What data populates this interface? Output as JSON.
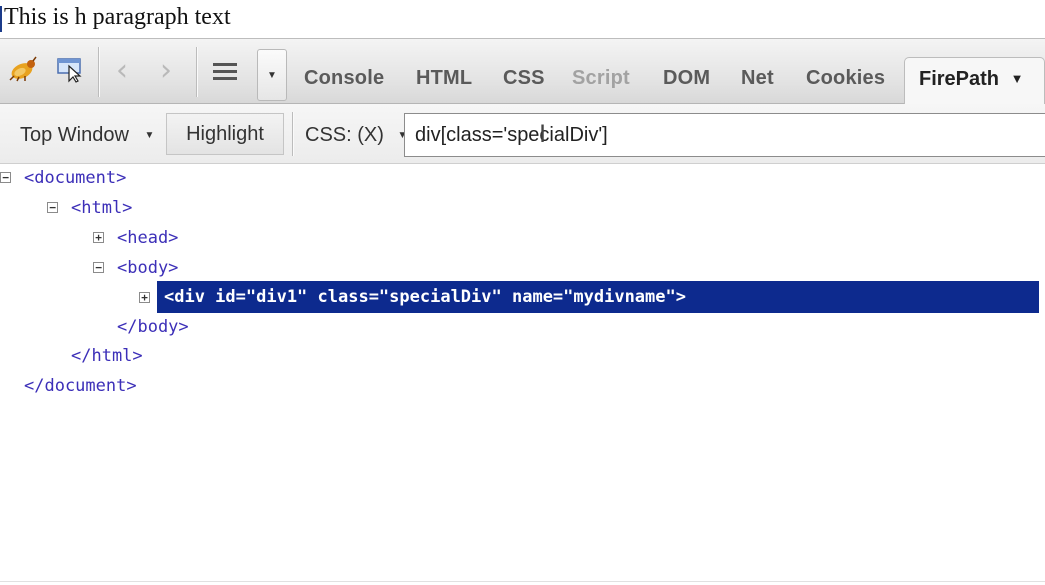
{
  "page": {
    "paragraph": "This is h paragraph text"
  },
  "toolbar": {
    "icons": [
      "firebug-bug-icon",
      "inspect-element-icon",
      "back-arrow-icon",
      "forward-arrow-icon",
      "menu-lines-icon",
      "dropdown-arrow-icon"
    ],
    "tabs": [
      {
        "label": "Console",
        "state": "normal"
      },
      {
        "label": "HTML",
        "state": "normal"
      },
      {
        "label": "CSS",
        "state": "normal"
      },
      {
        "label": "Script",
        "state": "disabled"
      },
      {
        "label": "DOM",
        "state": "normal"
      },
      {
        "label": "Net",
        "state": "normal"
      },
      {
        "label": "Cookies",
        "state": "normal"
      }
    ],
    "active_tab": "FirePath",
    "active_tab_arrow": "▼"
  },
  "firepath": {
    "window_select": "Top Window",
    "highlight_label": "Highlight",
    "mode_label": "CSS: (X)",
    "expression": "div[class='specialDiv']"
  },
  "tree": {
    "nodes": [
      {
        "text": "<document>",
        "toggle": "minus"
      },
      {
        "text": "<html>",
        "toggle": "minus"
      },
      {
        "text": "<head>",
        "toggle": "plus"
      },
      {
        "text": "<body>",
        "toggle": "minus"
      },
      {
        "text": "<div id=\"div1\" class=\"specialDiv\" name=\"mydivname\">",
        "toggle": "plus",
        "selected": true
      },
      {
        "text": "</body>",
        "toggle": null
      },
      {
        "text": "</html>",
        "toggle": null
      },
      {
        "text": "</document>",
        "toggle": null
      }
    ]
  },
  "colors": {
    "tag_text": "#3c2fb8",
    "selection_bg": "#0d2a8e",
    "toolbar_bg": "#e2e2e2"
  }
}
